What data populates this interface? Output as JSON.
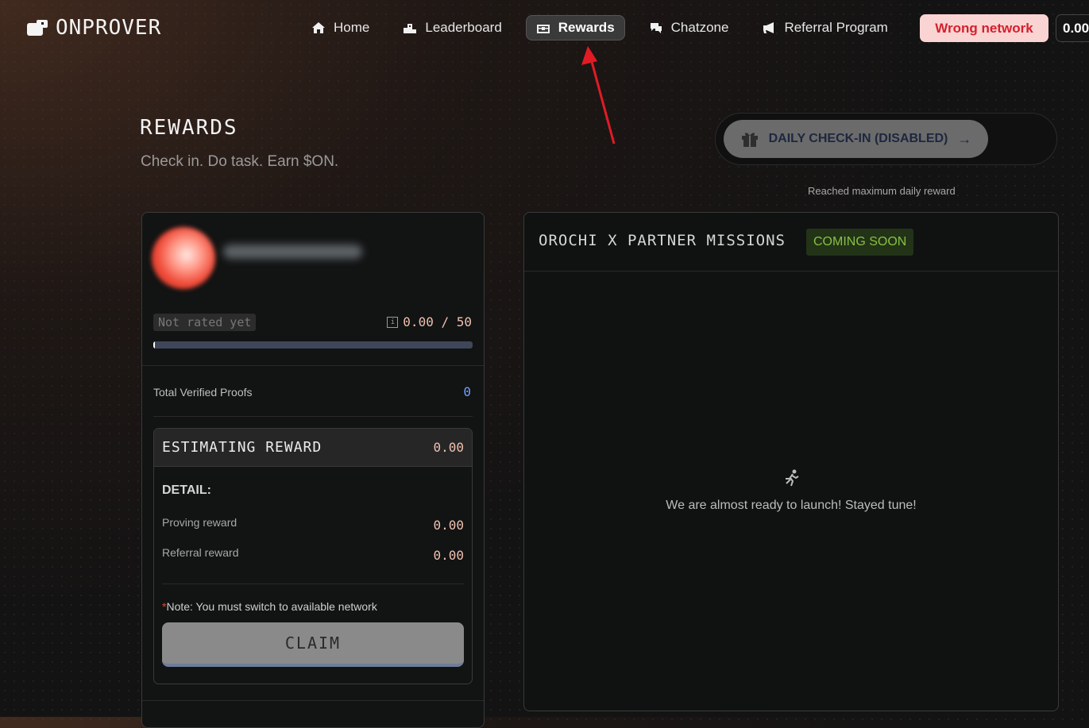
{
  "nav": {
    "logo": "ONPROVER",
    "items": [
      {
        "label": "Home",
        "icon": "home-icon"
      },
      {
        "label": "Leaderboard",
        "icon": "podium-icon"
      },
      {
        "label": "Rewards",
        "icon": "treasure-chest-icon",
        "active": true
      },
      {
        "label": "Chatzone",
        "icon": "chat-icon"
      },
      {
        "label": "Referral Program",
        "icon": "megaphone-icon"
      }
    ],
    "wrong_network": "Wrong network",
    "balance": "0.00"
  },
  "header": {
    "title": "REWARDS",
    "subtitle": "Check in. Do task. Earn $ON.",
    "checkin_label": "DAILY CHECK-IN (DISABLED)",
    "checkin_note": "Reached maximum daily reward"
  },
  "profile": {
    "rating": "Not rated yet",
    "score": "0.00 / 50",
    "progress_fraction": 0.005,
    "total_proofs_label": "Total Verified Proofs",
    "total_proofs_value": "0"
  },
  "estimate": {
    "title": "ESTIMATING REWARD",
    "total": "0.00",
    "detail_label": "DETAIL:",
    "proving_label": "Proving reward",
    "proving_value": "0.00",
    "referral_label": "Referral reward",
    "referral_value": "0.00",
    "note_star": "*",
    "note": "Note: You must switch to available network",
    "claim_label": "CLAIM"
  },
  "missions": {
    "title": "OROCHI X PARTNER MISSIONS",
    "badge": "COMING SOON",
    "message": "We are almost ready to launch! Stayed tune!"
  },
  "colors": {
    "accent_red": "#d61f2c",
    "badge_green": "#88c040",
    "value_peach": "#f0c0b0"
  }
}
